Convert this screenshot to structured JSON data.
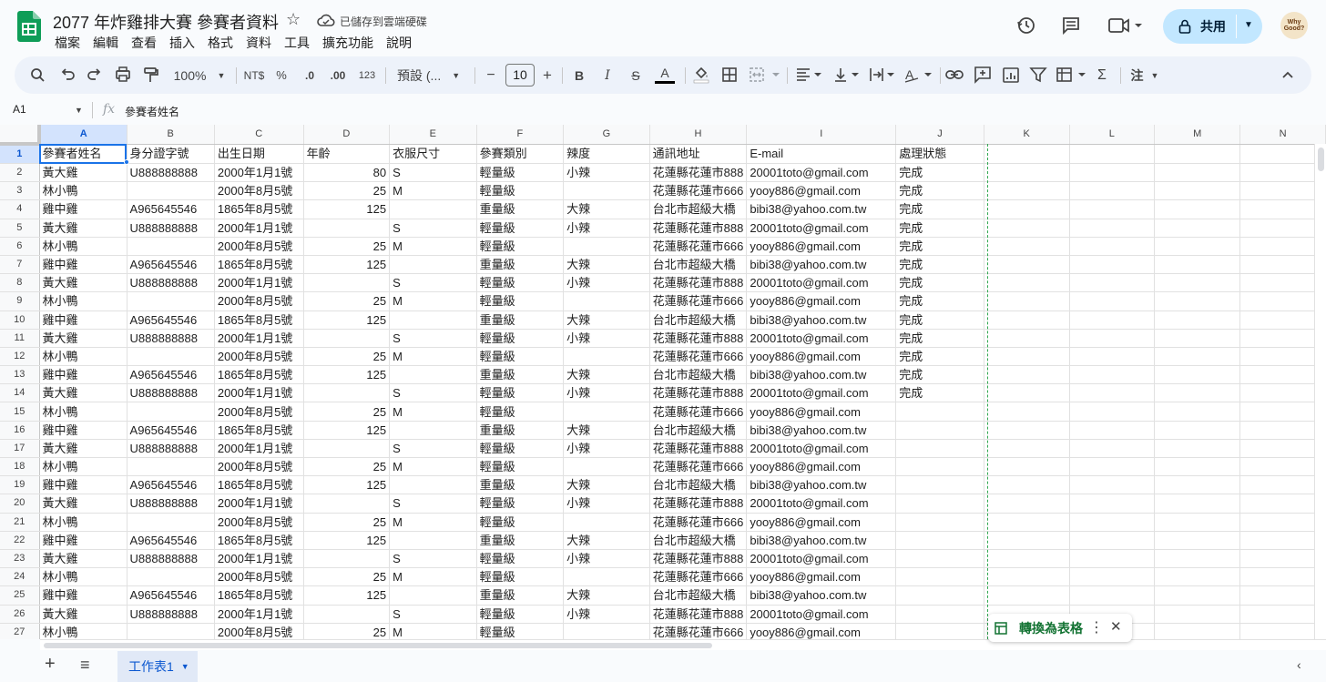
{
  "doc": {
    "title": "2077 年炸雞排大賽 參賽者資料",
    "saved_status": "已儲存到雲端硬碟"
  },
  "menu": [
    "檔案",
    "編輯",
    "查看",
    "插入",
    "格式",
    "資料",
    "工具",
    "擴充功能",
    "說明"
  ],
  "header_right": {
    "share_label": "共用",
    "avatar_text": "Why Good?"
  },
  "toolbar": {
    "zoom": "100%",
    "currency": "NT$",
    "percent": "%",
    "dec_decrease": ".0",
    "dec_increase": ".00",
    "number_format": "123",
    "font": "預設 (...",
    "font_size": "10",
    "minus": "−",
    "plus": "+",
    "bold": "B",
    "italic": "I",
    "strike": "S",
    "text_color": "A",
    "sigma": "Σ",
    "input_tools": "注"
  },
  "formula_bar": {
    "cell_ref": "A1",
    "fx": "fx",
    "content": "參賽者姓名"
  },
  "columns": [
    "A",
    "B",
    "C",
    "D",
    "E",
    "F",
    "G",
    "H",
    "I",
    "J",
    "K",
    "L",
    "M",
    "N"
  ],
  "rows": [
    {
      "n": "1",
      "c": [
        "參賽者姓名",
        "身分證字號",
        "出生日期",
        "年齡",
        "衣服尺寸",
        "參賽類別",
        "辣度",
        "通訊地址",
        "E-mail",
        "處理狀態"
      ]
    },
    {
      "n": "2",
      "c": [
        "黃大雞",
        "U888888888",
        "2000年1月1號",
        "80",
        "S",
        "輕量級",
        "小辣",
        "花蓮縣花蓮市888",
        "20001toto@gmail.com",
        "完成"
      ]
    },
    {
      "n": "3",
      "c": [
        "林小鴨",
        "",
        "2000年8月5號",
        "25",
        "M",
        "輕量級",
        "",
        "花蓮縣花蓮市666",
        "yooy886@gmail.com",
        "完成"
      ]
    },
    {
      "n": "4",
      "c": [
        "雞中雞",
        "A965645546",
        "1865年8月5號",
        "125",
        "",
        "重量級",
        "大辣",
        "台北市超級大橋",
        "bibi38@yahoo.com.tw",
        "完成"
      ]
    },
    {
      "n": "5",
      "c": [
        "黃大雞",
        "U888888888",
        "2000年1月1號",
        "",
        "S",
        "輕量級",
        "小辣",
        "花蓮縣花蓮市888",
        "20001toto@gmail.com",
        "完成"
      ]
    },
    {
      "n": "6",
      "c": [
        "林小鴨",
        "",
        "2000年8月5號",
        "25",
        "M",
        "輕量級",
        "",
        "花蓮縣花蓮市666",
        "yooy886@gmail.com",
        "完成"
      ]
    },
    {
      "n": "7",
      "c": [
        "雞中雞",
        "A965645546",
        "1865年8月5號",
        "125",
        "",
        "重量級",
        "大辣",
        "台北市超級大橋",
        "bibi38@yahoo.com.tw",
        "完成"
      ]
    },
    {
      "n": "8",
      "c": [
        "黃大雞",
        "U888888888",
        "2000年1月1號",
        "",
        "S",
        "輕量級",
        "小辣",
        "花蓮縣花蓮市888",
        "20001toto@gmail.com",
        "完成"
      ]
    },
    {
      "n": "9",
      "c": [
        "林小鴨",
        "",
        "2000年8月5號",
        "25",
        "M",
        "輕量級",
        "",
        "花蓮縣花蓮市666",
        "yooy886@gmail.com",
        "完成"
      ]
    },
    {
      "n": "10",
      "c": [
        "雞中雞",
        "A965645546",
        "1865年8月5號",
        "125",
        "",
        "重量級",
        "大辣",
        "台北市超級大橋",
        "bibi38@yahoo.com.tw",
        "完成"
      ]
    },
    {
      "n": "11",
      "c": [
        "黃大雞",
        "U888888888",
        "2000年1月1號",
        "",
        "S",
        "輕量級",
        "小辣",
        "花蓮縣花蓮市888",
        "20001toto@gmail.com",
        "完成"
      ]
    },
    {
      "n": "12",
      "c": [
        "林小鴨",
        "",
        "2000年8月5號",
        "25",
        "M",
        "輕量級",
        "",
        "花蓮縣花蓮市666",
        "yooy886@gmail.com",
        "完成"
      ]
    },
    {
      "n": "13",
      "c": [
        "雞中雞",
        "A965645546",
        "1865年8月5號",
        "125",
        "",
        "重量級",
        "大辣",
        "台北市超級大橋",
        "bibi38@yahoo.com.tw",
        "完成"
      ]
    },
    {
      "n": "14",
      "c": [
        "黃大雞",
        "U888888888",
        "2000年1月1號",
        "",
        "S",
        "輕量級",
        "小辣",
        "花蓮縣花蓮市888",
        "20001toto@gmail.com",
        "完成"
      ]
    },
    {
      "n": "15",
      "c": [
        "林小鴨",
        "",
        "2000年8月5號",
        "25",
        "M",
        "輕量級",
        "",
        "花蓮縣花蓮市666",
        "yooy886@gmail.com",
        ""
      ]
    },
    {
      "n": "16",
      "c": [
        "雞中雞",
        "A965645546",
        "1865年8月5號",
        "125",
        "",
        "重量級",
        "大辣",
        "台北市超級大橋",
        "bibi38@yahoo.com.tw",
        ""
      ]
    },
    {
      "n": "17",
      "c": [
        "黃大雞",
        "U888888888",
        "2000年1月1號",
        "",
        "S",
        "輕量級",
        "小辣",
        "花蓮縣花蓮市888",
        "20001toto@gmail.com",
        ""
      ]
    },
    {
      "n": "18",
      "c": [
        "林小鴨",
        "",
        "2000年8月5號",
        "25",
        "M",
        "輕量級",
        "",
        "花蓮縣花蓮市666",
        "yooy886@gmail.com",
        ""
      ]
    },
    {
      "n": "19",
      "c": [
        "雞中雞",
        "A965645546",
        "1865年8月5號",
        "125",
        "",
        "重量級",
        "大辣",
        "台北市超級大橋",
        "bibi38@yahoo.com.tw",
        ""
      ]
    },
    {
      "n": "20",
      "c": [
        "黃大雞",
        "U888888888",
        "2000年1月1號",
        "",
        "S",
        "輕量級",
        "小辣",
        "花蓮縣花蓮市888",
        "20001toto@gmail.com",
        ""
      ]
    },
    {
      "n": "21",
      "c": [
        "林小鴨",
        "",
        "2000年8月5號",
        "25",
        "M",
        "輕量級",
        "",
        "花蓮縣花蓮市666",
        "yooy886@gmail.com",
        ""
      ]
    },
    {
      "n": "22",
      "c": [
        "雞中雞",
        "A965645546",
        "1865年8月5號",
        "125",
        "",
        "重量級",
        "大辣",
        "台北市超級大橋",
        "bibi38@yahoo.com.tw",
        ""
      ]
    },
    {
      "n": "23",
      "c": [
        "黃大雞",
        "U888888888",
        "2000年1月1號",
        "",
        "S",
        "輕量級",
        "小辣",
        "花蓮縣花蓮市888",
        "20001toto@gmail.com",
        ""
      ]
    },
    {
      "n": "24",
      "c": [
        "林小鴨",
        "",
        "2000年8月5號",
        "25",
        "M",
        "輕量級",
        "",
        "花蓮縣花蓮市666",
        "yooy886@gmail.com",
        ""
      ]
    },
    {
      "n": "25",
      "c": [
        "雞中雞",
        "A965645546",
        "1865年8月5號",
        "125",
        "",
        "重量級",
        "大辣",
        "台北市超級大橋",
        "bibi38@yahoo.com.tw",
        ""
      ]
    },
    {
      "n": "26",
      "c": [
        "黃大雞",
        "U888888888",
        "2000年1月1號",
        "",
        "S",
        "輕量級",
        "小辣",
        "花蓮縣花蓮市888",
        "20001toto@gmail.com",
        ""
      ]
    },
    {
      "n": "27",
      "c": [
        "林小鴨",
        "",
        "2000年8月5號",
        "25",
        "M",
        "輕量級",
        "",
        "花蓮縣花蓮市666",
        "yooy886@gmail.com",
        ""
      ]
    }
  ],
  "sheet_tab": "工作表1",
  "toast": {
    "label": "轉換為表格"
  },
  "colors": {
    "accent": "#0b57d0",
    "share_bg": "#c2e7ff",
    "toolbar_bg": "#edf2fa",
    "selected_header": "#d3e3fd",
    "sheets_green": "#0f9d58",
    "toast_green": "#137333"
  }
}
